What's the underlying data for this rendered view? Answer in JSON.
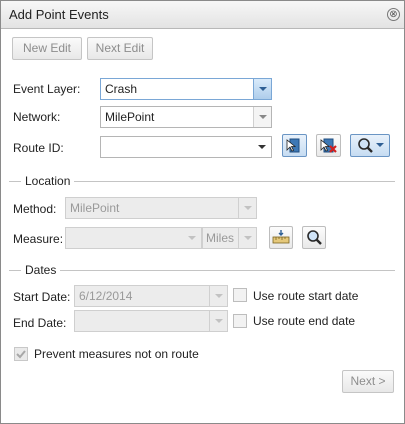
{
  "window": {
    "title": "Add Point Events",
    "close_glyph": "⊗"
  },
  "toolbar": {
    "new_edit_label": "New Edit",
    "next_edit_label": "Next Edit"
  },
  "form": {
    "event_layer": {
      "label": "Event Layer:",
      "value": "Crash"
    },
    "network": {
      "label": "Network:",
      "value": "MilePoint"
    },
    "route_id": {
      "label": "Route ID:",
      "value": ""
    }
  },
  "location": {
    "title": "Location",
    "method": {
      "label": "Method:",
      "value": "MilePoint"
    },
    "measure": {
      "label": "Measure:",
      "value": "",
      "unit": "Miles"
    }
  },
  "dates": {
    "title": "Dates",
    "start_date": {
      "label": "Start Date:",
      "value": "6/12/2014",
      "use_route_label": "Use route start date",
      "checked": false
    },
    "end_date": {
      "label": "End Date:",
      "value": "",
      "use_route_label": "Use route end date",
      "checked": false
    }
  },
  "options": {
    "prevent_label": "Prevent measures not on route",
    "checked": true
  },
  "footer": {
    "next_label": "Next >"
  },
  "colors": {
    "accent": "#7aa7d6",
    "disabled_text": "#999999",
    "title_bar": "#e3e3e3"
  },
  "icons": [
    "close-icon",
    "select-route-from-map-icon",
    "clear-route-icon",
    "zoom-search-icon",
    "select-measure-from-map-icon",
    "zoom-to-measure-icon",
    "checkmark-icon"
  ]
}
